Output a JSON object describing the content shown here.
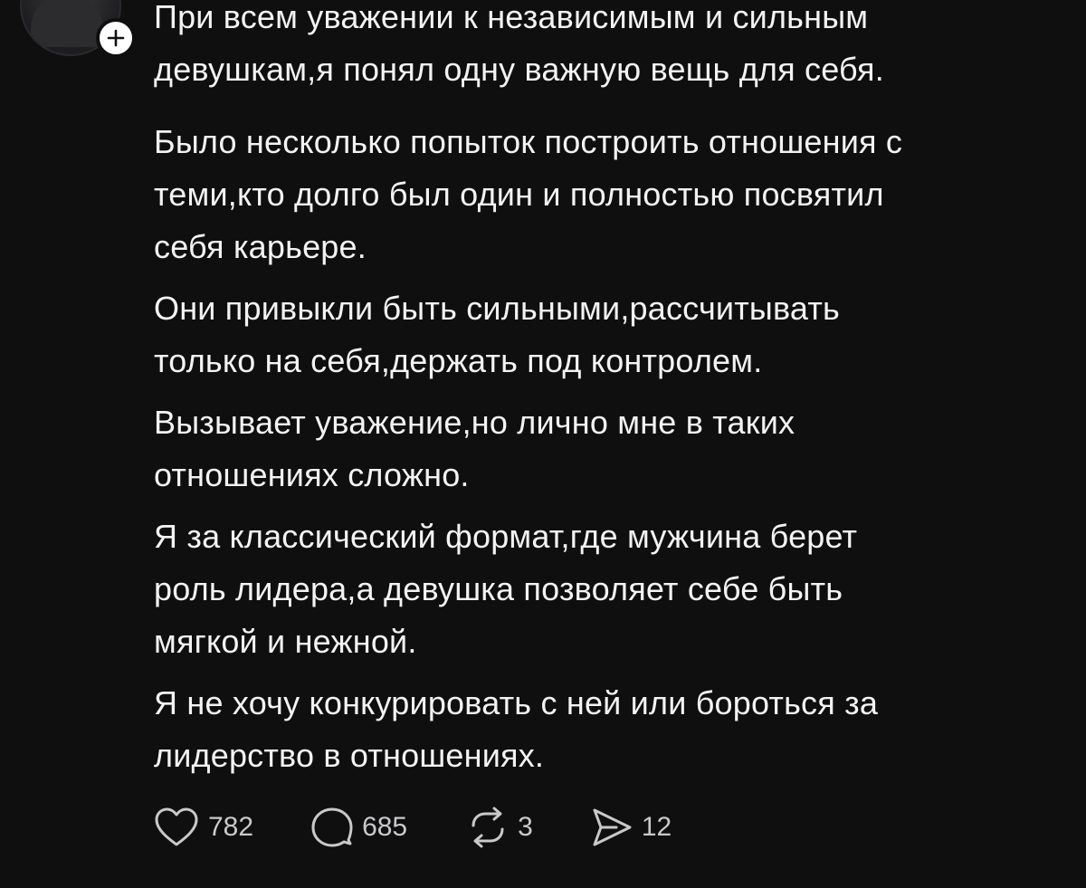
{
  "post": {
    "paragraphs": [
      {
        "lines": [
          "При всем уважении к независимым и сильным",
          "девушкам,я понял одну важную вещь для себя."
        ]
      },
      {
        "lines": [
          "Было несколько попыток построить отношения с",
          "теми,кто долго был один и полностью посвятил",
          "себя карьере."
        ]
      },
      {
        "lines": [
          "Они привыкли быть сильными,рассчитывать",
          "только на себя,держать под контролем."
        ]
      },
      {
        "lines": [
          "Вызывает уважение,но лично мне в таких",
          "отношениях сложно."
        ]
      },
      {
        "lines": [
          "Я за классический формат,где мужчина берет",
          "роль лидера,а девушка позволяет себе быть",
          "мягкой и нежной."
        ]
      },
      {
        "lines": [
          "Я не хочу конкурировать с ней или бороться за",
          "лидерство в отношениях."
        ]
      }
    ]
  },
  "actions": {
    "like": {
      "icon": "heart-icon",
      "count": "782"
    },
    "reply": {
      "icon": "comment-icon",
      "count": "685"
    },
    "repost": {
      "icon": "repost-icon",
      "count": "3"
    },
    "share": {
      "icon": "send-icon",
      "count": "12"
    }
  },
  "avatar": {
    "icon": "plus-icon"
  },
  "colors": {
    "background": "#0f0f10",
    "text": "#f3f3f3",
    "icon": "#c9c9cb",
    "follow_button": "#ffffff"
  }
}
